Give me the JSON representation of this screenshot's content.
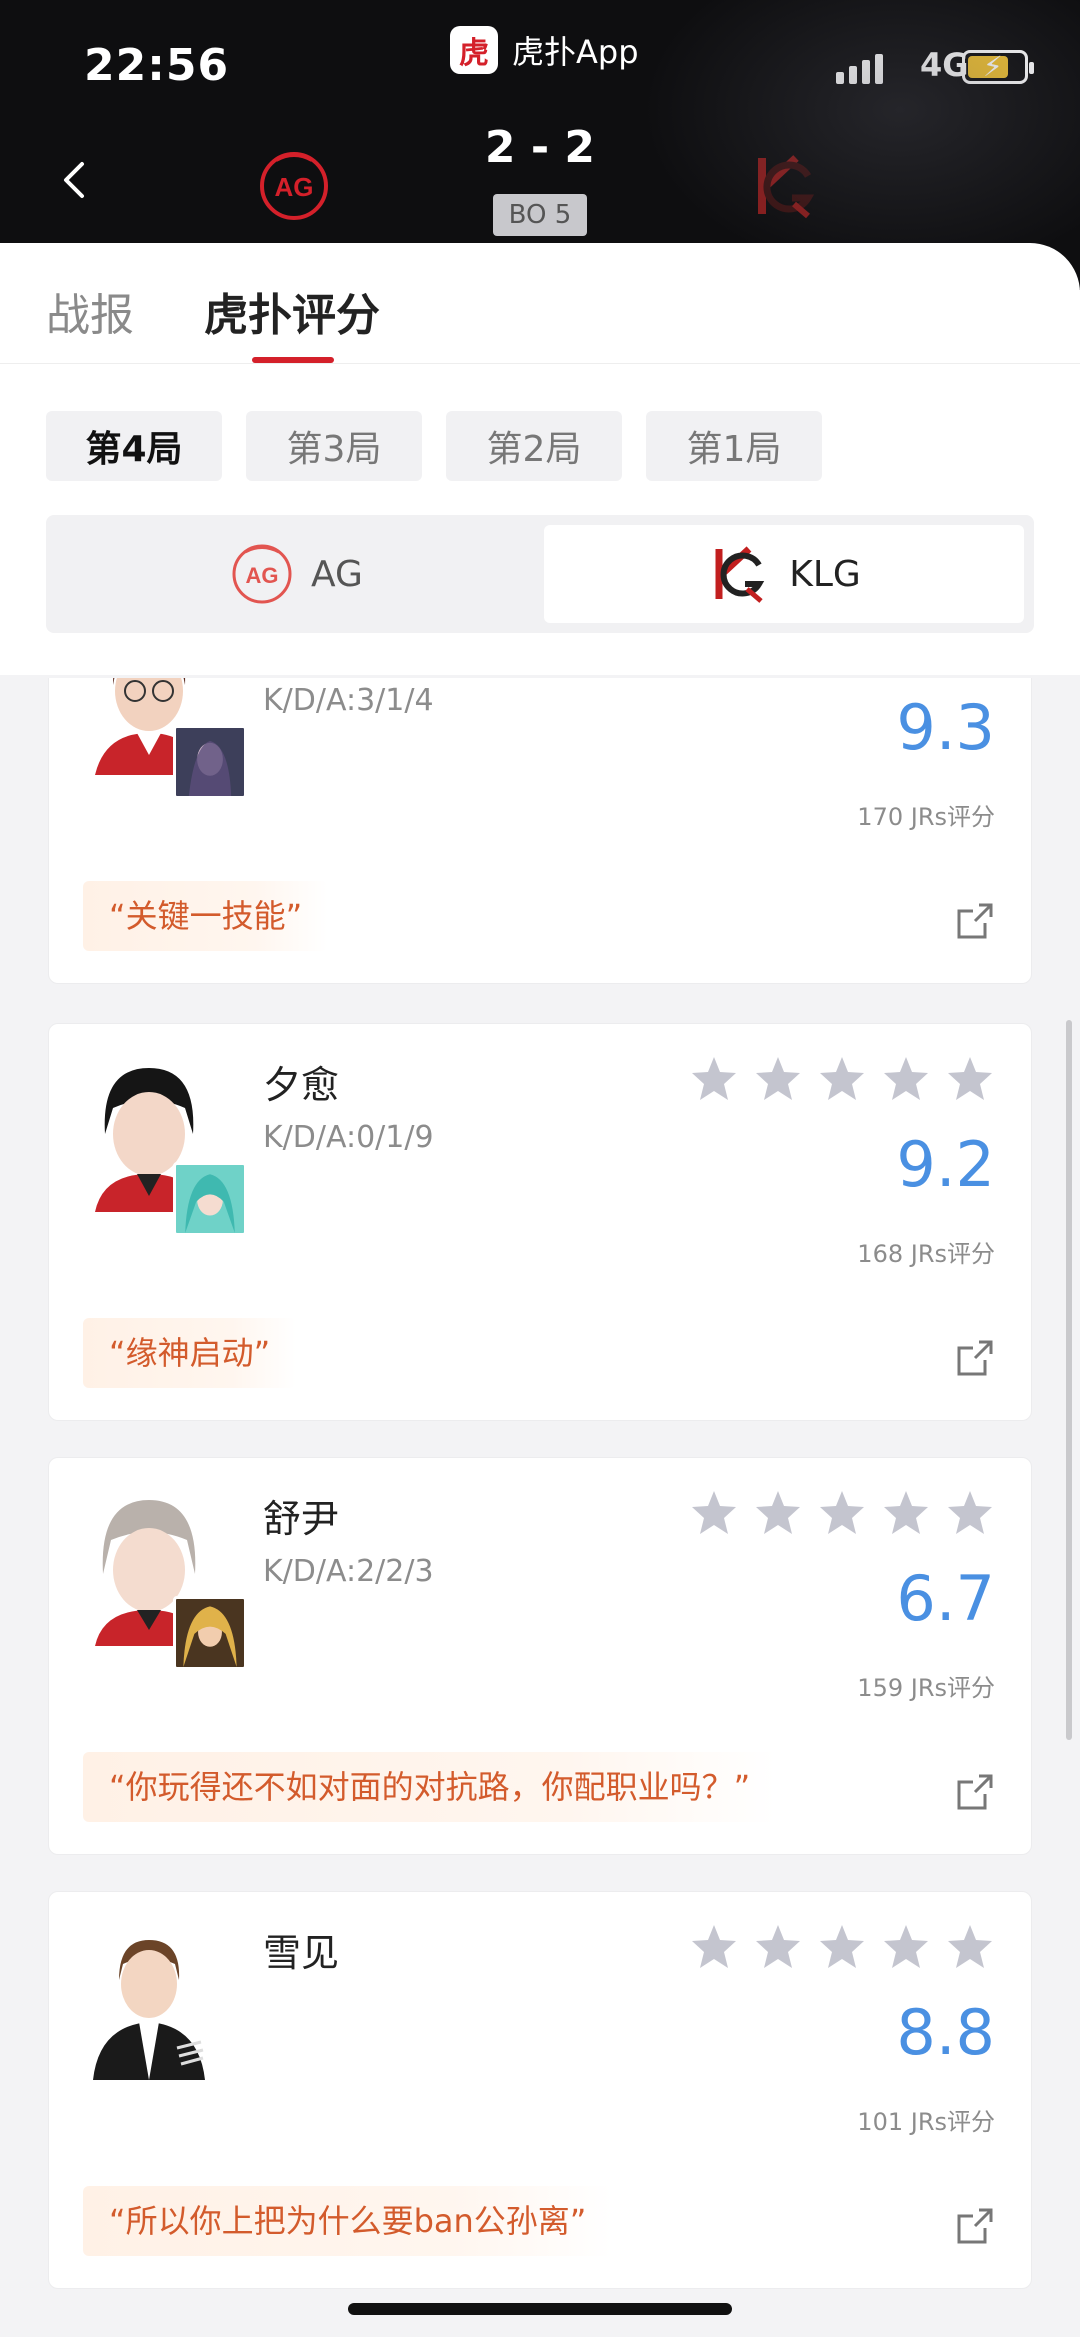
{
  "status_bar": {
    "time": "22:56",
    "app_name": "虎扑App",
    "app_icon_char": "虎",
    "network": "4G"
  },
  "match": {
    "score": "2 - 2",
    "format": "BO 5"
  },
  "tabs": [
    {
      "label": "战报"
    },
    {
      "label": "虎扑评分"
    }
  ],
  "rounds": [
    {
      "label": "第4局"
    },
    {
      "label": "第3局"
    },
    {
      "label": "第2局"
    },
    {
      "label": "第1局"
    }
  ],
  "teams": [
    {
      "name": "AG"
    },
    {
      "name": "KLG"
    }
  ],
  "players": [
    {
      "name": "",
      "kda": "K/D/A:3/1/4",
      "score": "9.3",
      "jr_count": "170 JRs评分",
      "quote": "“关键一技能”"
    },
    {
      "name": "夕愈",
      "kda": "K/D/A:0/1/9",
      "score": "9.2",
      "jr_count": "168 JRs评分",
      "quote": "“缘神启动”"
    },
    {
      "name": "舒尹",
      "kda": "K/D/A:2/2/3",
      "score": "6.7",
      "jr_count": "159 JRs评分",
      "quote": "“你玩得还不如对面的对抗路，你配职业吗？”"
    },
    {
      "name": "雪见",
      "kda": "",
      "score": "8.8",
      "jr_count": "101 JRs评分",
      "quote": "“所以你上把为什么要ban公孙离”"
    }
  ],
  "colors": {
    "accent_red": "#d4202a",
    "score_blue": "#4a90e2",
    "quote_orange": "#d35b2c"
  },
  "icons": [
    "back-icon",
    "ag-logo",
    "klg-logo",
    "star-icon",
    "share-icon"
  ]
}
